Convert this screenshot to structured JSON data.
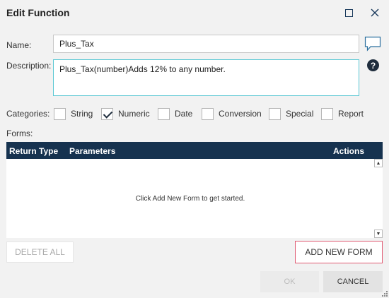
{
  "dialog": {
    "title": "Edit Function"
  },
  "icons": {
    "maximize": "maximize-icon",
    "close": "close-icon",
    "comment": "comment-icon",
    "help": "help-icon"
  },
  "form": {
    "name_label": "Name:",
    "name_value": "Plus_Tax",
    "description_label": "Description:",
    "description_value": "Plus_Tax(number)Adds 12% to any number."
  },
  "categories": {
    "label": "Categories:",
    "items": [
      {
        "label": "String",
        "checked": false
      },
      {
        "label": "Numeric",
        "checked": true
      },
      {
        "label": "Date",
        "checked": false
      },
      {
        "label": "Conversion",
        "checked": false
      },
      {
        "label": "Special",
        "checked": false
      },
      {
        "label": "Report",
        "checked": false
      }
    ]
  },
  "forms": {
    "label": "Forms:",
    "columns": {
      "return_type": "Return Type",
      "parameters": "Parameters",
      "actions": "Actions"
    },
    "empty_message": "Click Add New Form to get started.",
    "delete_all_label": "DELETE ALL",
    "add_new_form_label": "ADD NEW FORM"
  },
  "footer": {
    "ok_label": "OK",
    "cancel_label": "CANCEL"
  },
  "colors": {
    "header_bg": "#16324f",
    "accent_border": "#e05a72",
    "focus_border": "#5bc8d4"
  }
}
